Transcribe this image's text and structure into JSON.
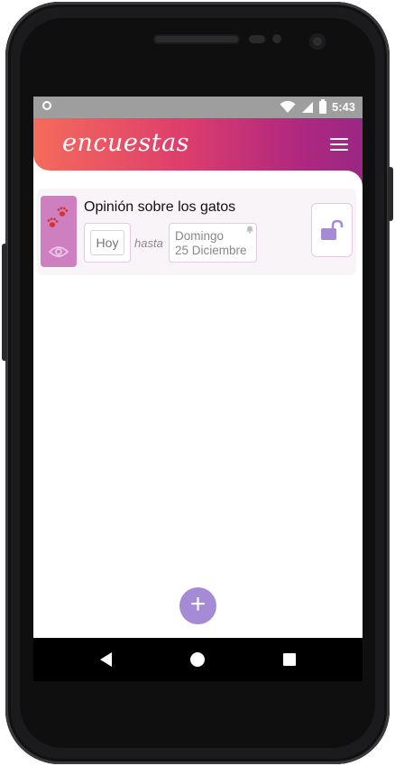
{
  "statusbar": {
    "time": "5:43"
  },
  "appbar": {
    "title": "encuestas",
    "menu_icon": "hamburger-menu-icon"
  },
  "poll_card": {
    "title": "Opinión sobre los gatos",
    "start_label": "Hoy",
    "between_label": "hasta",
    "end_day": "Domingo",
    "end_date": "25 Diciembre",
    "category_icon": "paw-prints-icon",
    "visibility_icon": "eye-icon",
    "lock_icon": "unlocked-padlock-icon",
    "colors": {
      "accent": "#cd7fc0",
      "lock": "#a58bd6"
    }
  },
  "fab": {
    "label": "+",
    "color": "#a58bd6"
  },
  "theme": {
    "gradient_start": "#f56b5b",
    "gradient_end": "#9a2784"
  }
}
